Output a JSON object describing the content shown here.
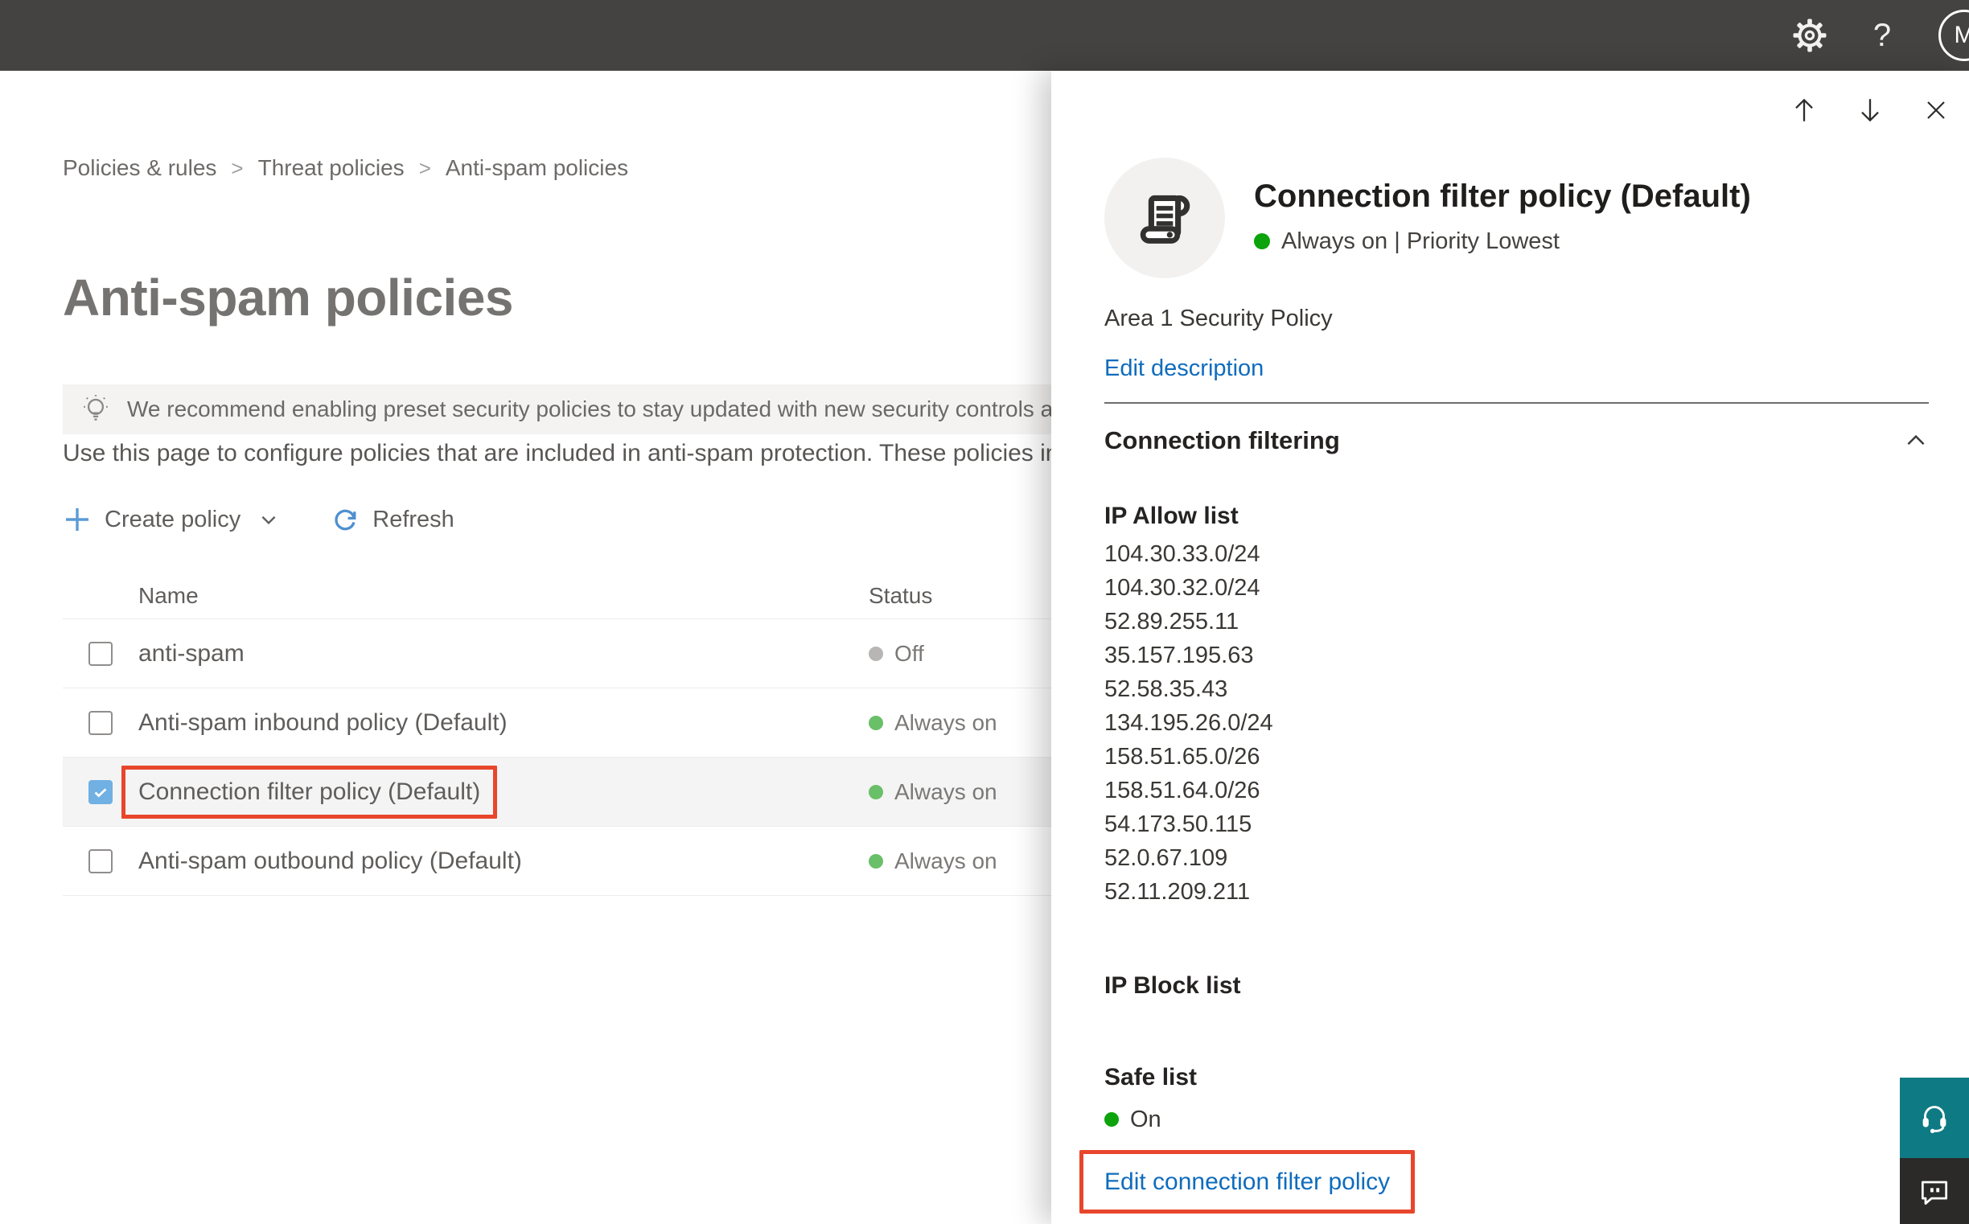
{
  "topbar": {
    "avatar_initial": "M",
    "help_glyph": "?"
  },
  "breadcrumb": {
    "separator": ">",
    "items": [
      "Policies & rules",
      "Threat policies",
      "Anti-spam policies"
    ]
  },
  "page": {
    "title": "Anti-spam policies",
    "banner": "We recommend enabling preset security policies to stay updated with new security controls and our recomme",
    "description": "Use this page to configure policies that are included in anti-spam protection. These policies include"
  },
  "toolbar": {
    "create_policy": "Create policy",
    "refresh": "Refresh"
  },
  "table": {
    "columns": [
      "Name",
      "Status"
    ],
    "rows": [
      {
        "name": "anti-spam",
        "status": "Off",
        "status_color": "#b8b6b4",
        "checked": false,
        "selected": false,
        "highlighted": false
      },
      {
        "name": "Anti-spam inbound policy (Default)",
        "status": "Always on",
        "status_color": "#6abf69",
        "checked": false,
        "selected": false,
        "highlighted": false
      },
      {
        "name": "Connection filter policy (Default)",
        "status": "Always on",
        "status_color": "#6abf69",
        "checked": true,
        "selected": true,
        "highlighted": true
      },
      {
        "name": "Anti-spam outbound policy (Default)",
        "status": "Always on",
        "status_color": "#6abf69",
        "checked": false,
        "selected": false,
        "highlighted": false
      }
    ]
  },
  "flyout": {
    "title": "Connection filter policy (Default)",
    "status": "Always on | Priority Lowest",
    "status_color": "#0ca30c",
    "policy_description": "Area 1 Security Policy",
    "edit_description_link": "Edit description",
    "section_title": "Connection filtering",
    "ip_allow_title": "IP Allow list",
    "ip_allow": [
      "104.30.33.0/24",
      "104.30.32.0/24",
      "52.89.255.11",
      "35.157.195.63",
      "52.58.35.43",
      "134.195.26.0/24",
      "158.51.65.0/26",
      "158.51.64.0/26",
      "54.173.50.115",
      "52.0.67.109",
      "52.11.209.211"
    ],
    "ip_block_title": "IP Block list",
    "safe_list_title": "Safe list",
    "safe_list_status": "On",
    "edit_link": "Edit connection filter policy"
  },
  "colors": {
    "topbar": "#454341",
    "accent_blue": "#0f6cbd",
    "toolbar_blue": "#5b9bd5",
    "highlight_red": "#e8462c",
    "status_green_table": "#6abf69",
    "status_green_flyout": "#0ca30c",
    "status_gray_off": "#b8b6b4",
    "support_teal": "#0e7a84",
    "chat_dark": "#2b2a29"
  }
}
